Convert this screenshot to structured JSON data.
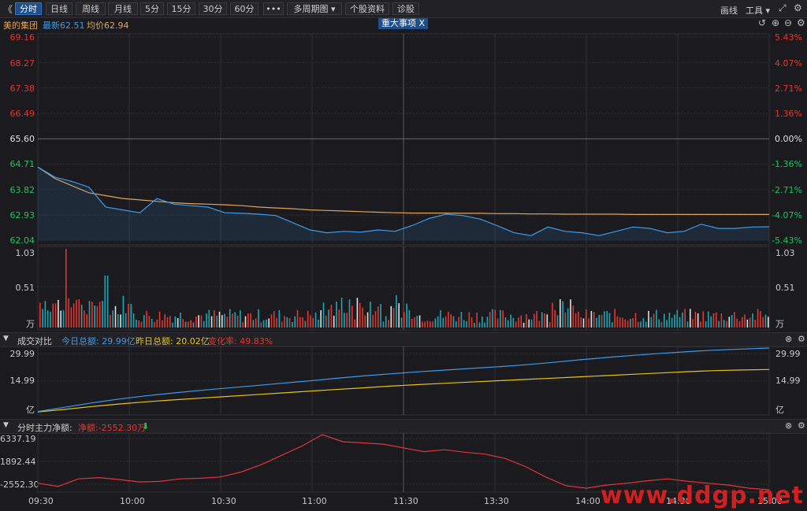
{
  "toolbar": {
    "left_arrow": "《",
    "periods": [
      "分时",
      "日线",
      "周线",
      "月线",
      "5分",
      "15分",
      "30分",
      "60分"
    ],
    "more": "•••",
    "multi_period": "多周期图",
    "stock_info": "个股资料",
    "diagnose": "诊股",
    "draw_line": "画线",
    "tools": "工具",
    "active_period": "分时"
  },
  "info": {
    "stock_name": "美的集团",
    "latest": "最新62.51",
    "average": "均价62.94",
    "event_button": "重大事项",
    "event_close": "X"
  },
  "price_axis": {
    "left": [
      "69.16",
      "68.27",
      "67.38",
      "66.49",
      "65.60",
      "64.71",
      "63.82",
      "62.93",
      "62.04"
    ],
    "right": [
      "5.43%",
      "4.07%",
      "2.71%",
      "1.36%",
      "0.00%",
      "-1.36%",
      "-2.71%",
      "-4.07%",
      "-5.43%"
    ]
  },
  "volume_axis": {
    "left": [
      "1.03",
      "0.51",
      "万"
    ],
    "right": [
      "1.03",
      "0.51",
      "万"
    ]
  },
  "amount_section": {
    "title": "成交对比",
    "today": "今日总额: 29.99亿",
    "yesterday": "昨日总额: 20.02亿",
    "change": "变化率: 49.83%",
    "axis_left": [
      "29.99",
      "14.99",
      "亿"
    ],
    "axis_right": [
      "29.99",
      "14.99",
      "亿"
    ]
  },
  "flow_section": {
    "title": "分时主力净额:",
    "net": "净额:-2552.30万",
    "arrow": "⬇",
    "axis_left": [
      "6337.19",
      "1892.44",
      "-2552.30"
    ]
  },
  "time_axis": [
    "09:30",
    "10:00",
    "10:30",
    "11:00",
    "11:30",
    "13:30",
    "14:00",
    "14:30",
    "15:00"
  ],
  "watermark": "www.ddgp.net",
  "colors": {
    "up": "#e8342c",
    "down": "#21c25e",
    "price_line": "#3d9be9",
    "avg_line": "#e0a35a",
    "yesterday_line": "#e6c21c",
    "flow_line": "#e0353a",
    "neutral": "#e0e0e0"
  },
  "chart_data": [
    {
      "type": "line",
      "title": "美的集团",
      "series": [
        {
          "name": "最新",
          "values": [
            64.6,
            64.25,
            64.1,
            63.9,
            63.2,
            63.1,
            63.0,
            63.5,
            63.3,
            63.25,
            63.2,
            63.0,
            62.98,
            62.95,
            62.9,
            62.65,
            62.4,
            62.3,
            62.35,
            62.32,
            62.4,
            62.35,
            62.55,
            62.8,
            62.95,
            62.9,
            62.78,
            62.55,
            62.3,
            62.2,
            62.5,
            62.35,
            62.3,
            62.2,
            62.35,
            62.5,
            62.45,
            62.3,
            62.35,
            62.6,
            62.45,
            62.45,
            62.5,
            62.51
          ]
        },
        {
          "name": "均价",
          "values": [
            64.6,
            64.2,
            63.95,
            63.7,
            63.6,
            63.5,
            63.45,
            63.4,
            63.35,
            63.32,
            63.3,
            63.28,
            63.25,
            63.2,
            63.17,
            63.14,
            63.1,
            63.08,
            63.06,
            63.04,
            63.02,
            63.0,
            62.99,
            62.99,
            62.99,
            62.98,
            62.98,
            62.97,
            62.97,
            62.96,
            62.96,
            62.95,
            62.95,
            62.95,
            62.95,
            62.94,
            62.94,
            62.94,
            62.94,
            62.94,
            62.94,
            62.94,
            62.94,
            62.94
          ]
        }
      ],
      "ylim": [
        62.04,
        69.16
      ]
    },
    {
      "type": "line",
      "title": "成交对比",
      "series": [
        {
          "name": "今日总额",
          "values": [
            0.5,
            2.5,
            4.5,
            6.3,
            7.8,
            9.1,
            10.3,
            11.4,
            12.5,
            13.6,
            14.7,
            15.9,
            17.0,
            18.0,
            18.9,
            19.7,
            20.5,
            21.3,
            22.2,
            23.3,
            24.5,
            25.6,
            26.6,
            27.5,
            28.3,
            29.0,
            29.5,
            29.99
          ]
        },
        {
          "name": "昨日总额",
          "values": [
            0.3,
            1.5,
            2.8,
            4.0,
            5.0,
            5.9,
            6.7,
            7.5,
            8.3,
            9.1,
            9.9,
            10.7,
            11.5,
            12.3,
            13.0,
            13.6,
            14.2,
            14.8,
            15.4,
            16.0,
            16.6,
            17.2,
            17.8,
            18.4,
            19.0,
            19.5,
            19.8,
            20.02
          ]
        }
      ],
      "ylim": [
        0,
        29.99
      ]
    },
    {
      "type": "line",
      "title": "分时主力净额",
      "series": [
        {
          "name": "净额",
          "values": [
            -1500,
            -2000,
            -800,
            -600,
            -900,
            -1300,
            -1200,
            -800,
            -700,
            -500,
            300,
            1500,
            3000,
            4500,
            6337,
            5200,
            5000,
            4800,
            4200,
            3600,
            3900,
            3500,
            3200,
            2500,
            1200,
            -500,
            -1900,
            -2300,
            -1800,
            -1500,
            -1100,
            -800,
            -1200,
            -1500,
            -1800,
            -2300,
            -2552
          ]
        }
      ],
      "ylim": [
        -2552.3,
        6337.19
      ]
    }
  ]
}
